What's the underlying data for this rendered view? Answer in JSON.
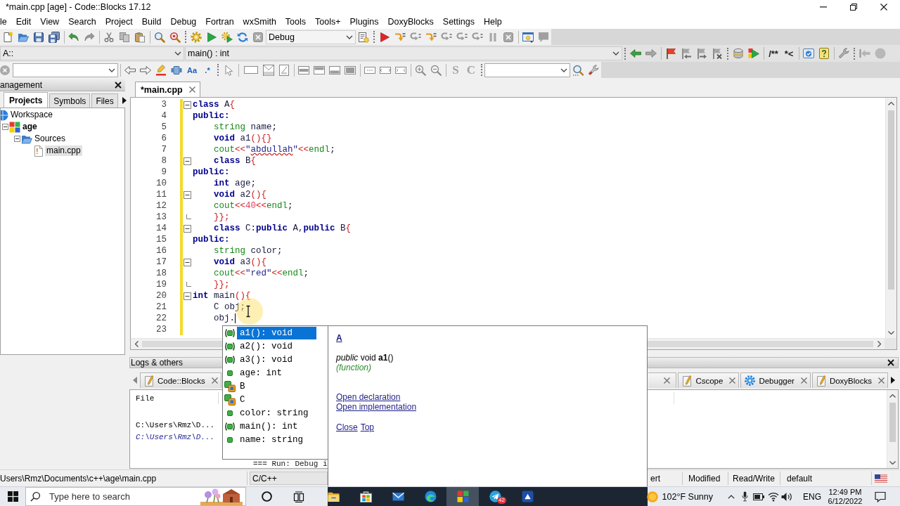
{
  "window": {
    "title": "*main.cpp [age] - Code::Blocks 17.12"
  },
  "menu": [
    "le",
    "Edit",
    "View",
    "Search",
    "Project",
    "Build",
    "Debug",
    "Fortran",
    "wxSmith",
    "Tools",
    "Tools+",
    "Plugins",
    "DoxyBlocks",
    "Settings",
    "Help"
  ],
  "toolbar_main": {
    "build_target": "Debug"
  },
  "toolbar_code": {
    "scope": "A::",
    "function": "main() : int",
    "doxy_buttons": [
      {
        "text": "/**",
        "disabled": false
      },
      {
        "text": "*<",
        "disabled": false
      }
    ]
  },
  "toolbar_search": {
    "find_buttons": [
      {
        "text": "Aa",
        "disabled": false
      },
      {
        "text": ".*",
        "disabled": false
      }
    ],
    "letter_buttons": [
      {
        "text": "S",
        "disabled": true
      },
      {
        "text": "C",
        "disabled": true
      }
    ]
  },
  "management": {
    "title": "anagement",
    "tabs": [
      {
        "label": "Projects",
        "selected": true
      },
      {
        "label": "Symbols",
        "selected": false
      },
      {
        "label": "Files",
        "selected": false
      }
    ],
    "tree": [
      {
        "label": "Workspace",
        "kind": "workspace",
        "selected": false,
        "children": [
          {
            "label": "age",
            "kind": "project",
            "active": true,
            "expanded": true,
            "selected": false,
            "children": [
              {
                "label": "Sources",
                "kind": "folder",
                "expanded": true,
                "selected": false,
                "children": [
                  {
                    "label": "main.cpp",
                    "kind": "file",
                    "selected": true
                  }
                ]
              }
            ]
          }
        ]
      }
    ]
  },
  "editor": {
    "tabs": [
      {
        "label": "*main.cpp",
        "selected": true
      }
    ],
    "lines": [
      {
        "number": "3",
        "fold_open": true,
        "fold_end": false,
        "modified": true,
        "caret": false,
        "tokens": [
          {
            "kind": "kw",
            "text": "class"
          },
          {
            "kind": "id",
            "text": " A"
          },
          {
            "kind": "op",
            "text": "{"
          }
        ]
      },
      {
        "number": "4",
        "fold_open": false,
        "fold_end": false,
        "modified": true,
        "caret": false,
        "tokens": [
          {
            "kind": "kw",
            "text": "public:"
          }
        ]
      },
      {
        "number": "5",
        "fold_open": false,
        "fold_end": false,
        "modified": true,
        "caret": false,
        "tokens": [
          {
            "kind": "ty",
            "text": "    string"
          },
          {
            "kind": "id",
            "text": " name;"
          }
        ]
      },
      {
        "number": "6",
        "fold_open": false,
        "fold_end": false,
        "modified": true,
        "caret": false,
        "tokens": [
          {
            "kind": "kw",
            "text": "    void"
          },
          {
            "kind": "id",
            "text": " a1"
          },
          {
            "kind": "op",
            "text": "(){}"
          }
        ]
      },
      {
        "number": "7",
        "fold_open": false,
        "fold_end": false,
        "modified": true,
        "caret": false,
        "tokens": [
          {
            "kind": "ty",
            "text": "    cout"
          },
          {
            "kind": "op",
            "text": "<<"
          },
          {
            "kind": "str",
            "text": "\""
          },
          {
            "kind": "misspelled",
            "text": "abdullah"
          },
          {
            "kind": "str",
            "text": "\""
          },
          {
            "kind": "op",
            "text": "<<"
          },
          {
            "kind": "ty",
            "text": "endl"
          },
          {
            "kind": "id",
            "text": ";"
          }
        ]
      },
      {
        "number": "8",
        "fold_open": true,
        "fold_end": false,
        "modified": true,
        "caret": false,
        "tokens": [
          {
            "kind": "kw",
            "text": "    class"
          },
          {
            "kind": "id",
            "text": " B"
          },
          {
            "kind": "op",
            "text": "{"
          }
        ]
      },
      {
        "number": "9",
        "fold_open": false,
        "fold_end": false,
        "modified": true,
        "caret": false,
        "tokens": [
          {
            "kind": "kw",
            "text": "public:"
          }
        ]
      },
      {
        "number": "10",
        "fold_open": false,
        "fold_end": false,
        "modified": true,
        "caret": false,
        "tokens": [
          {
            "kind": "kw",
            "text": "    int"
          },
          {
            "kind": "id",
            "text": " age;"
          }
        ]
      },
      {
        "number": "11",
        "fold_open": true,
        "fold_end": false,
        "modified": true,
        "caret": false,
        "tokens": [
          {
            "kind": "kw",
            "text": "    void"
          },
          {
            "kind": "id",
            "text": " a2"
          },
          {
            "kind": "op",
            "text": "(){"
          }
        ]
      },
      {
        "number": "12",
        "fold_open": false,
        "fold_end": false,
        "modified": true,
        "caret": false,
        "tokens": [
          {
            "kind": "ty",
            "text": "    cout"
          },
          {
            "kind": "op",
            "text": "<<"
          },
          {
            "kind": "num",
            "text": "40"
          },
          {
            "kind": "op",
            "text": "<<"
          },
          {
            "kind": "ty",
            "text": "endl"
          },
          {
            "kind": "id",
            "text": ";"
          }
        ]
      },
      {
        "number": "13",
        "fold_open": false,
        "fold_end": true,
        "modified": true,
        "caret": false,
        "tokens": [
          {
            "kind": "op",
            "text": "    }};"
          }
        ]
      },
      {
        "number": "14",
        "fold_open": true,
        "fold_end": false,
        "modified": true,
        "caret": false,
        "tokens": [
          {
            "kind": "kw",
            "text": "    class"
          },
          {
            "kind": "id",
            "text": " C:"
          },
          {
            "kind": "kw",
            "text": "public"
          },
          {
            "kind": "id",
            "text": " A,"
          },
          {
            "kind": "kw",
            "text": "public"
          },
          {
            "kind": "id",
            "text": " B"
          },
          {
            "kind": "op",
            "text": "{"
          }
        ]
      },
      {
        "number": "15",
        "fold_open": false,
        "fold_end": false,
        "modified": true,
        "caret": false,
        "tokens": [
          {
            "kind": "kw",
            "text": "public:"
          }
        ]
      },
      {
        "number": "16",
        "fold_open": false,
        "fold_end": false,
        "modified": true,
        "caret": false,
        "tokens": [
          {
            "kind": "ty",
            "text": "    string"
          },
          {
            "kind": "id",
            "text": " color;"
          }
        ]
      },
      {
        "number": "17",
        "fold_open": true,
        "fold_end": false,
        "modified": true,
        "caret": false,
        "tokens": [
          {
            "kind": "kw",
            "text": "    void"
          },
          {
            "kind": "id",
            "text": " a3"
          },
          {
            "kind": "op",
            "text": "(){"
          }
        ]
      },
      {
        "number": "18",
        "fold_open": false,
        "fold_end": false,
        "modified": true,
        "caret": false,
        "tokens": [
          {
            "kind": "ty",
            "text": "    cout"
          },
          {
            "kind": "op",
            "text": "<<"
          },
          {
            "kind": "str",
            "text": "\"red\""
          },
          {
            "kind": "op",
            "text": "<<"
          },
          {
            "kind": "ty",
            "text": "endl"
          },
          {
            "kind": "id",
            "text": ";"
          }
        ]
      },
      {
        "number": "19",
        "fold_open": false,
        "fold_end": true,
        "modified": true,
        "caret": false,
        "tokens": [
          {
            "kind": "op",
            "text": "    }};"
          }
        ]
      },
      {
        "number": "20",
        "fold_open": true,
        "fold_end": false,
        "modified": true,
        "caret": false,
        "tokens": [
          {
            "kind": "kw",
            "text": "int"
          },
          {
            "kind": "id",
            "text": " main"
          },
          {
            "kind": "op",
            "text": "(){"
          }
        ]
      },
      {
        "number": "21",
        "fold_open": false,
        "fold_end": false,
        "modified": true,
        "caret": false,
        "tokens": [
          {
            "kind": "id",
            "text": "    C obj;"
          }
        ]
      },
      {
        "number": "22",
        "fold_open": false,
        "fold_end": false,
        "modified": true,
        "caret": true,
        "tokens": [
          {
            "kind": "id",
            "text": "    obj."
          }
        ]
      },
      {
        "number": "23",
        "fold_open": false,
        "fold_end": false,
        "modified": true,
        "caret": false
      }
    ]
  },
  "autocomplete": {
    "items": [
      {
        "label": "a1(): void",
        "kind": "method",
        "selected": true
      },
      {
        "label": "a2(): void",
        "kind": "method",
        "selected": false
      },
      {
        "label": "a3(): void",
        "kind": "method",
        "selected": false
      },
      {
        "label": "age: int",
        "kind": "field",
        "selected": false
      },
      {
        "label": "B",
        "kind": "class",
        "selected": false
      },
      {
        "label": "C",
        "kind": "class",
        "selected": false
      },
      {
        "label": "color: string",
        "kind": "field",
        "selected": false
      },
      {
        "label": "main(): int",
        "kind": "method",
        "selected": false
      },
      {
        "label": "name: string",
        "kind": "field",
        "selected": false
      }
    ]
  },
  "doc_popup": {
    "scope": "A",
    "signature": "*public* void **a1**()",
    "kind_label": "(function)",
    "links": [
      "Open declaration",
      "Open implementation"
    ],
    "footer_links": [
      "Close",
      "Top"
    ]
  },
  "logs": {
    "title": "Logs & others",
    "tabs": [
      {
        "kind": "log",
        "label": "Code::Blocks"
      },
      {
        "kind": "covered"
      },
      {
        "kind": "log",
        "label": "Cscope"
      },
      {
        "kind": "debugger",
        "label": "Debugger"
      },
      {
        "kind": "log",
        "label": "DoxyBlocks"
      }
    ],
    "column": "File",
    "rows": [
      {
        "kind": "path",
        "file": "C:\\Users\\Rmz\\D..."
      },
      {
        "kind": "note",
        "file": "C:\\Users\\Rmz\\D..."
      },
      {
        "kind": "run",
        "message": "=== Run: Debug i"
      }
    ]
  },
  "status_bar": {
    "path": "Users\\Rmz\\Documents\\c++\\age\\main.cpp",
    "language": "C/C++",
    "fields": [
      "ert",
      "Modified",
      "Read/Write",
      "default"
    ]
  },
  "taskbar": {
    "search_placeholder": "Type here to search",
    "apps": [
      {
        "active": false
      },
      {
        "active": false
      },
      {
        "active": false
      },
      {
        "active": false
      },
      {
        "active": true
      },
      {
        "active": false,
        "badge": "42"
      },
      {
        "active": false
      }
    ],
    "weather": "102°F Sunny",
    "language": "ENG",
    "time": "12:49 PM",
    "date": "6/12/2022"
  }
}
